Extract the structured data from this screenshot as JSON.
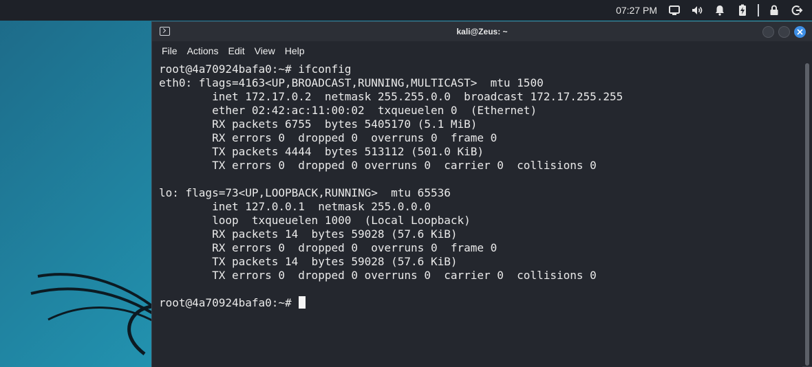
{
  "panel": {
    "clock": "07:27 PM",
    "icons": [
      "display-icon",
      "volume-icon",
      "notification-bell-icon",
      "battery-charging-icon",
      "lock-icon",
      "logout-icon"
    ]
  },
  "window": {
    "title": "kali@Zeus: ~",
    "menu": [
      "File",
      "Actions",
      "Edit",
      "View",
      "Help"
    ]
  },
  "terminal": {
    "lines": [
      "root@4a70924bafa0:~# ifconfig",
      "eth0: flags=4163<UP,BROADCAST,RUNNING,MULTICAST>  mtu 1500",
      "        inet 172.17.0.2  netmask 255.255.0.0  broadcast 172.17.255.255",
      "        ether 02:42:ac:11:00:02  txqueuelen 0  (Ethernet)",
      "        RX packets 6755  bytes 5405170 (5.1 MiB)",
      "        RX errors 0  dropped 0  overruns 0  frame 0",
      "        TX packets 4444  bytes 513112 (501.0 KiB)",
      "        TX errors 0  dropped 0 overruns 0  carrier 0  collisions 0",
      "",
      "lo: flags=73<UP,LOOPBACK,RUNNING>  mtu 65536",
      "        inet 127.0.0.1  netmask 255.0.0.0",
      "        loop  txqueuelen 1000  (Local Loopback)",
      "        RX packets 14  bytes 59028 (57.6 KiB)",
      "        RX errors 0  dropped 0  overruns 0  frame 0",
      "        TX packets 14  bytes 59028 (57.6 KiB)",
      "        TX errors 0  dropped 0 overruns 0  carrier 0  collisions 0",
      "",
      "root@4a70924bafa0:~#"
    ]
  },
  "colors": {
    "close_button": "#3d8ee5",
    "terminal_bg": "#24272e",
    "panel_bg": "#1e2128"
  }
}
